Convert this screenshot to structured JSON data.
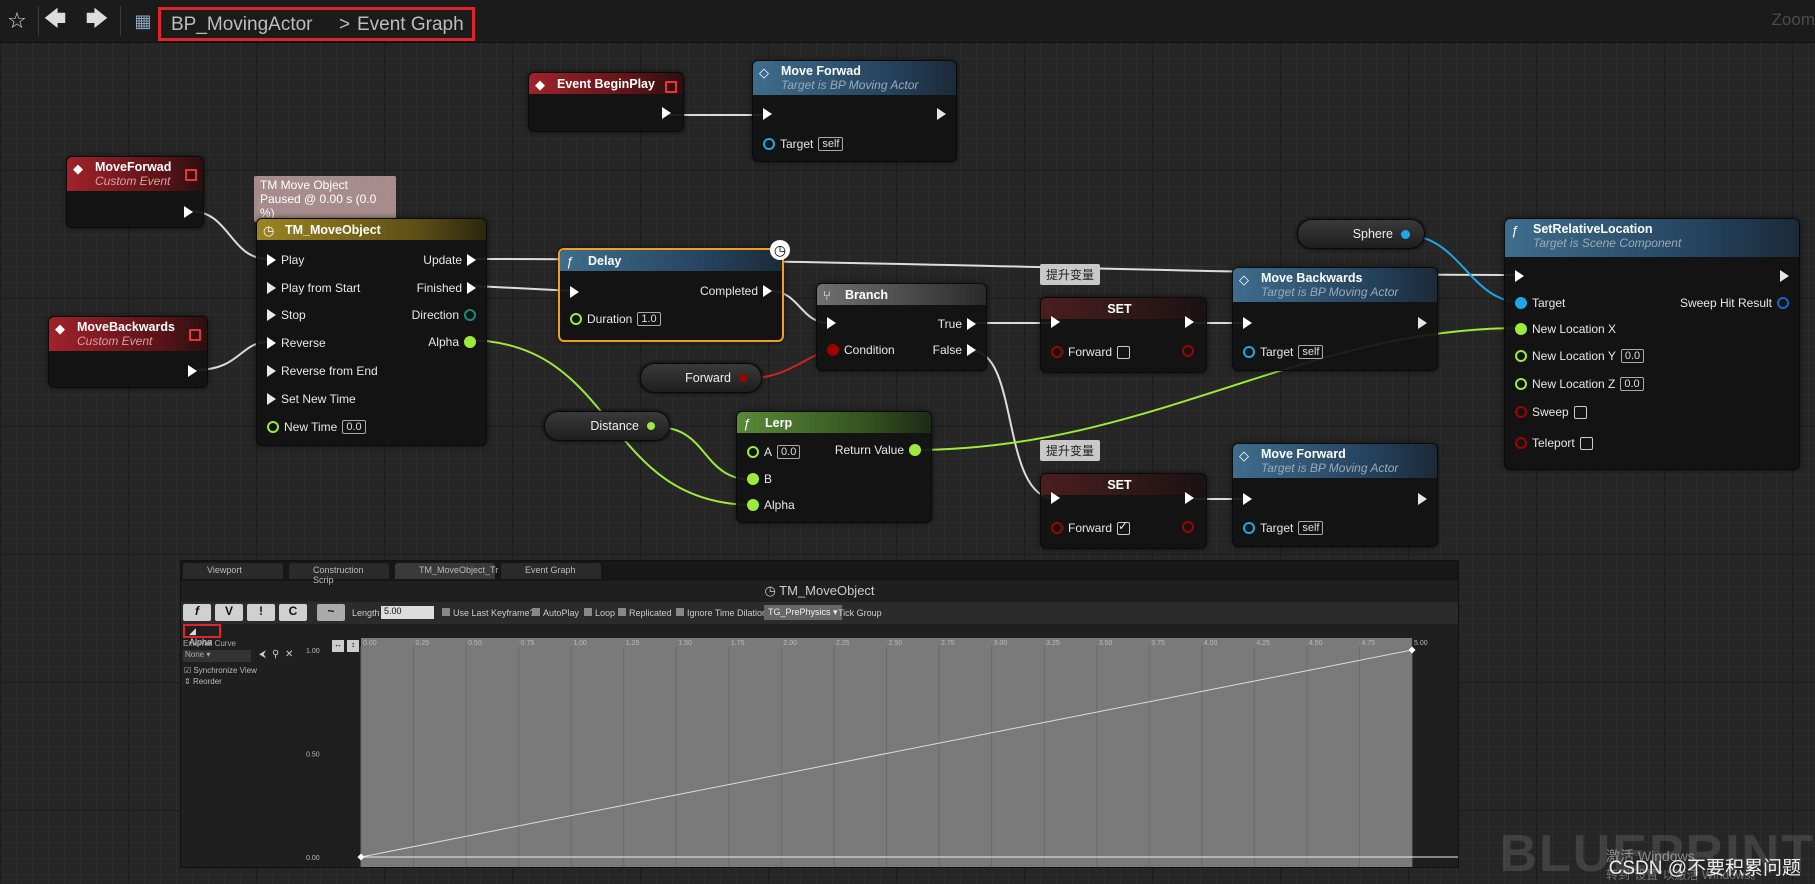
{
  "toolbar": {
    "star_icon": "star-icon",
    "back_icon": "back-arrow-icon",
    "forward_icon": "forward-arrow-icon",
    "blueprint_icon": "blueprint-icon",
    "breadcrumb": [
      "BP_MovingActor",
      "Event Graph"
    ],
    "breadcrumb_sep": ">",
    "zoom": "Zoom"
  },
  "nodes": {
    "event_beginplay": {
      "title": "Event BeginPlay"
    },
    "move_forwad_top": {
      "title": "Move Forwad",
      "subtitle": "Target is BP Moving Actor",
      "target_label": "Target",
      "target_value": "self"
    },
    "moveforwad_event": {
      "title": "MoveForwad",
      "subtitle": "Custom Event"
    },
    "movebackwards_event": {
      "title": "MoveBackwards",
      "subtitle": "Custom Event"
    },
    "timeline_comment": {
      "line1": "TM Move Object",
      "line2": "Paused @ 0.00 s (0.0 %)"
    },
    "tm_moveobject": {
      "title": "TM_MoveObject",
      "inputs": [
        "Play",
        "Play from Start",
        "Stop",
        "Reverse",
        "Reverse from End",
        "Set New Time",
        "New Time"
      ],
      "new_time_value": "0.0",
      "outputs": [
        "Update",
        "Finished",
        "Direction",
        "Alpha"
      ]
    },
    "delay": {
      "title": "Delay",
      "completed": "Completed",
      "duration_label": "Duration",
      "duration_value": "1.0"
    },
    "branch": {
      "title": "Branch",
      "condition": "Condition",
      "true_label": "True",
      "false_label": "False"
    },
    "forward_var": {
      "label": "Forward"
    },
    "distance_var": {
      "label": "Distance"
    },
    "lerp": {
      "title": "Lerp",
      "a_label": "A",
      "a_value": "0.0",
      "b_label": "B",
      "alpha_label": "Alpha",
      "return_label": "Return Value"
    },
    "set_top": {
      "title": "SET",
      "comment": "提升变量",
      "forward_label": "Forward",
      "checked": false
    },
    "set_bottom": {
      "title": "SET",
      "comment": "提升变量",
      "forward_label": "Forward",
      "checked": true
    },
    "move_backwards": {
      "title": "Move Backwards",
      "subtitle": "Target is BP Moving Actor",
      "target_label": "Target",
      "target_value": "self"
    },
    "move_forward": {
      "title": "Move Forward",
      "subtitle": "Target is BP Moving Actor",
      "target_label": "Target",
      "target_value": "self"
    },
    "sphere_var": {
      "label": "Sphere"
    },
    "set_relative_location": {
      "title": "SetRelativeLocation",
      "subtitle": "Target is Scene Component",
      "target_label": "Target",
      "sweep_hit": "Sweep Hit Result",
      "new_x": "New Location X",
      "new_y": "New Location Y",
      "new_y_value": "0.0",
      "new_z": "New Location Z",
      "new_z_value": "0.0",
      "sweep": "Sweep",
      "teleport": "Teleport"
    }
  },
  "timeline_panel": {
    "tabs": [
      "Viewport",
      "Construction Scrip",
      "TM_MoveObject_Tr",
      "Event Graph"
    ],
    "title": "TM_MoveObject",
    "buttons": [
      "f",
      "V",
      "!",
      "C",
      "~"
    ],
    "length_label": "Length",
    "length_value": "5.00",
    "options": [
      "Use Last Keyframe?",
      "AutoPlay",
      "Loop",
      "Replicated",
      "Ignore Time Dilation"
    ],
    "tick_group_value": "TG_PrePhysics",
    "tick_group_label": "Tick Group",
    "track_name": "Alpha",
    "external_curve_label": "External Curve",
    "external_curve_value": "None",
    "sync_view": "Synchronize View",
    "reorder": "Reorder",
    "x_ticks": [
      "0.00",
      "0.25",
      "0.50",
      "0.75",
      "1.00",
      "1.25",
      "1.50",
      "1.75",
      "2.00",
      "2.25",
      "2.50",
      "2.75",
      "3.00",
      "3.25",
      "3.50",
      "3.75",
      "4.00",
      "4.25",
      "4.50",
      "4.75",
      "5.00"
    ],
    "y_ticks": [
      "1.00",
      "0.50",
      "0.00"
    ],
    "keys": [
      {
        "t": 0.0,
        "v": 0.0
      },
      {
        "t": 5.0,
        "v": 1.0
      }
    ]
  },
  "watermarks": {
    "csdn": "CSDN @不要积累问题",
    "blueprint": "BLUEPRINT",
    "windows1": "激活 Windows",
    "windows2": "转到\"设置\"以激活 Windows。"
  },
  "colors": {
    "breadcrumb_highlight": "#e0242b",
    "exec_pin": "#ffffff",
    "float_pin": "#9ceb3c",
    "bool_pin": "#a10000",
    "object_pin": "#00a8f0",
    "delay_border": "#f0a020"
  }
}
